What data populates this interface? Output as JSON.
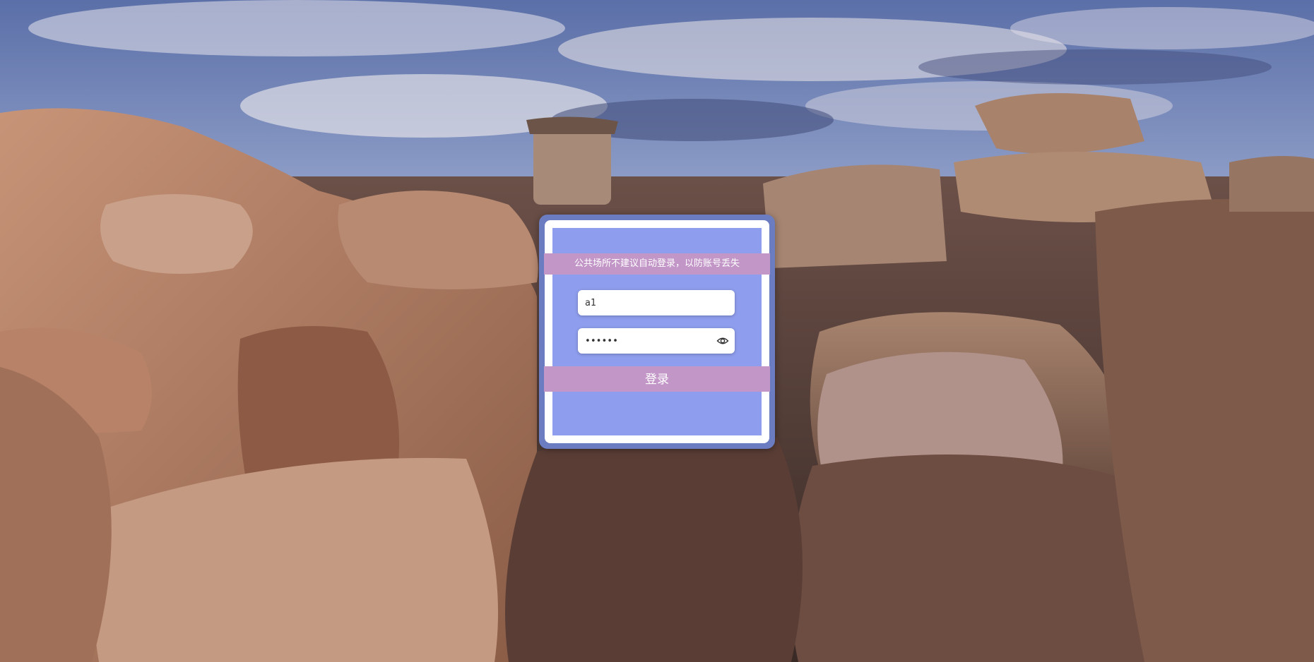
{
  "background": {
    "description_icon": "landscape-photo",
    "sky_color": "#6d7fb3",
    "rock_color": "#9a6e57"
  },
  "login": {
    "notice": "公共场所不建议自动登录，以防账号丢失",
    "username_value": "a1",
    "password_value": "••••••",
    "submit_label": "登录",
    "faint_link": "",
    "show_password_icon": "eye-icon"
  },
  "colors": {
    "card_border": "#6b7cc0",
    "card_fill": "#8e9ded",
    "accent": "#c396c8"
  }
}
